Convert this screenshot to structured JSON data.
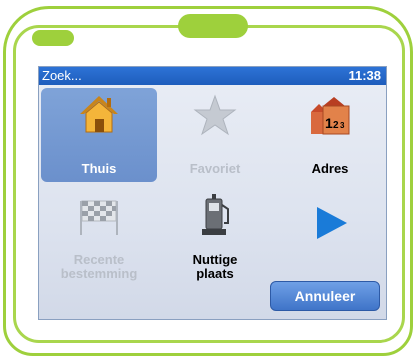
{
  "status_bar": {
    "title": "Zoek...",
    "time": "11:38"
  },
  "menu": {
    "items": [
      {
        "label": "Thuis",
        "icon": "home-icon",
        "state": "selected"
      },
      {
        "label": "Favoriet",
        "icon": "star-icon",
        "state": "disabled"
      },
      {
        "label": "Adres",
        "icon": "address-icon",
        "state": "enabled"
      },
      {
        "label": "Recente bestemming",
        "icon": "checkered-flag-icon",
        "state": "disabled"
      },
      {
        "label": "Nuttige plaats",
        "icon": "gas-pump-icon",
        "state": "enabled"
      },
      {
        "label": "",
        "icon": "next-arrow-icon",
        "state": "enabled"
      }
    ]
  },
  "cancel_button": {
    "label": "Annuleer"
  },
  "colors": {
    "device_green": "#9ed03c",
    "status_blue": "#1e5dbc",
    "selected_tile": "#7fa3d8",
    "arrow_blue": "#1a7bd8"
  }
}
